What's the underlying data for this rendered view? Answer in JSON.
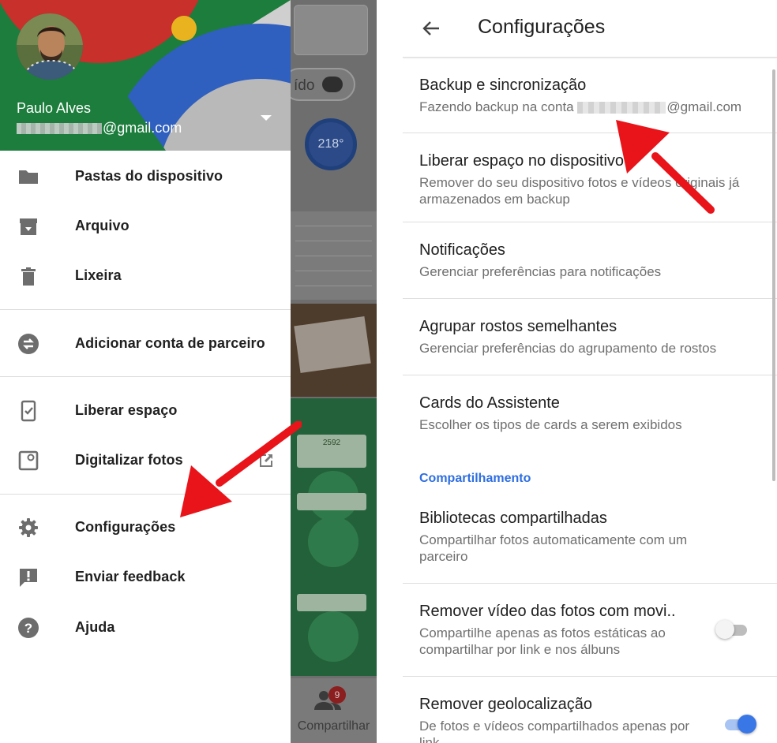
{
  "drawer": {
    "user_name": "Paulo Alves",
    "user_email_suffix": "@gmail.com",
    "items": [
      {
        "label": "Pastas do dispositivo",
        "icon": "folder-icon"
      },
      {
        "label": "Arquivo",
        "icon": "archive-icon"
      },
      {
        "label": "Lixeira",
        "icon": "trash-icon"
      },
      {
        "label": "Adicionar conta de parceiro",
        "icon": "partner-swap-icon"
      },
      {
        "label": "Liberar espaço",
        "icon": "phone-check-icon"
      },
      {
        "label": "Digitalizar fotos",
        "icon": "photoscan-icon"
      },
      {
        "label": "Configurações",
        "icon": "gear-icon"
      },
      {
        "label": "Enviar feedback",
        "icon": "feedback-icon"
      },
      {
        "label": "Ajuda",
        "icon": "help-icon"
      }
    ]
  },
  "background_app": {
    "pill_text": "ído",
    "gauge_value": "218",
    "gauge_unit": "°",
    "card_count": "2592",
    "bottom_nav_label": "Compartilhar",
    "badge_count": "9"
  },
  "settings": {
    "title": "Configurações",
    "items": [
      {
        "title": "Backup e sincronização",
        "desc_prefix": "Fazendo backup na conta ",
        "desc_suffix": "@gmail.com"
      },
      {
        "title": "Liberar espaço no dispositivo",
        "desc": "Remover do seu dispositivo fotos e vídeos originais já armazenados em backup"
      },
      {
        "title": "Notificações",
        "desc": "Gerenciar preferências para notificações"
      },
      {
        "title": "Agrupar rostos semelhantes",
        "desc": "Gerenciar preferências do agrupamento de rostos"
      },
      {
        "title": "Cards do Assistente",
        "desc": "Escolher os tipos de cards a serem exibidos"
      }
    ],
    "section_header": "Compartilhamento",
    "sharing_items": [
      {
        "title": "Bibliotecas compartilhadas",
        "desc": "Compartilhar fotos automaticamente com um parceiro"
      },
      {
        "title": "Remover vídeo das fotos com movi..",
        "desc": "Compartilhe apenas as fotos estáticas ao compartilhar por link e nos álbuns",
        "toggle": "off"
      },
      {
        "title": "Remover geolocalização",
        "desc": "De fotos e vídeos compartilhados apenas por link",
        "toggle": "on"
      }
    ]
  },
  "colors": {
    "accent_blue": "#2e6ee0",
    "toggle_on": "#3a77e6",
    "arrow_red": "#e8141a",
    "header_green": "#1c7d3c",
    "header_red": "#c8302b",
    "header_blue": "#2f5fbf",
    "header_yellow": "#e9b320"
  }
}
